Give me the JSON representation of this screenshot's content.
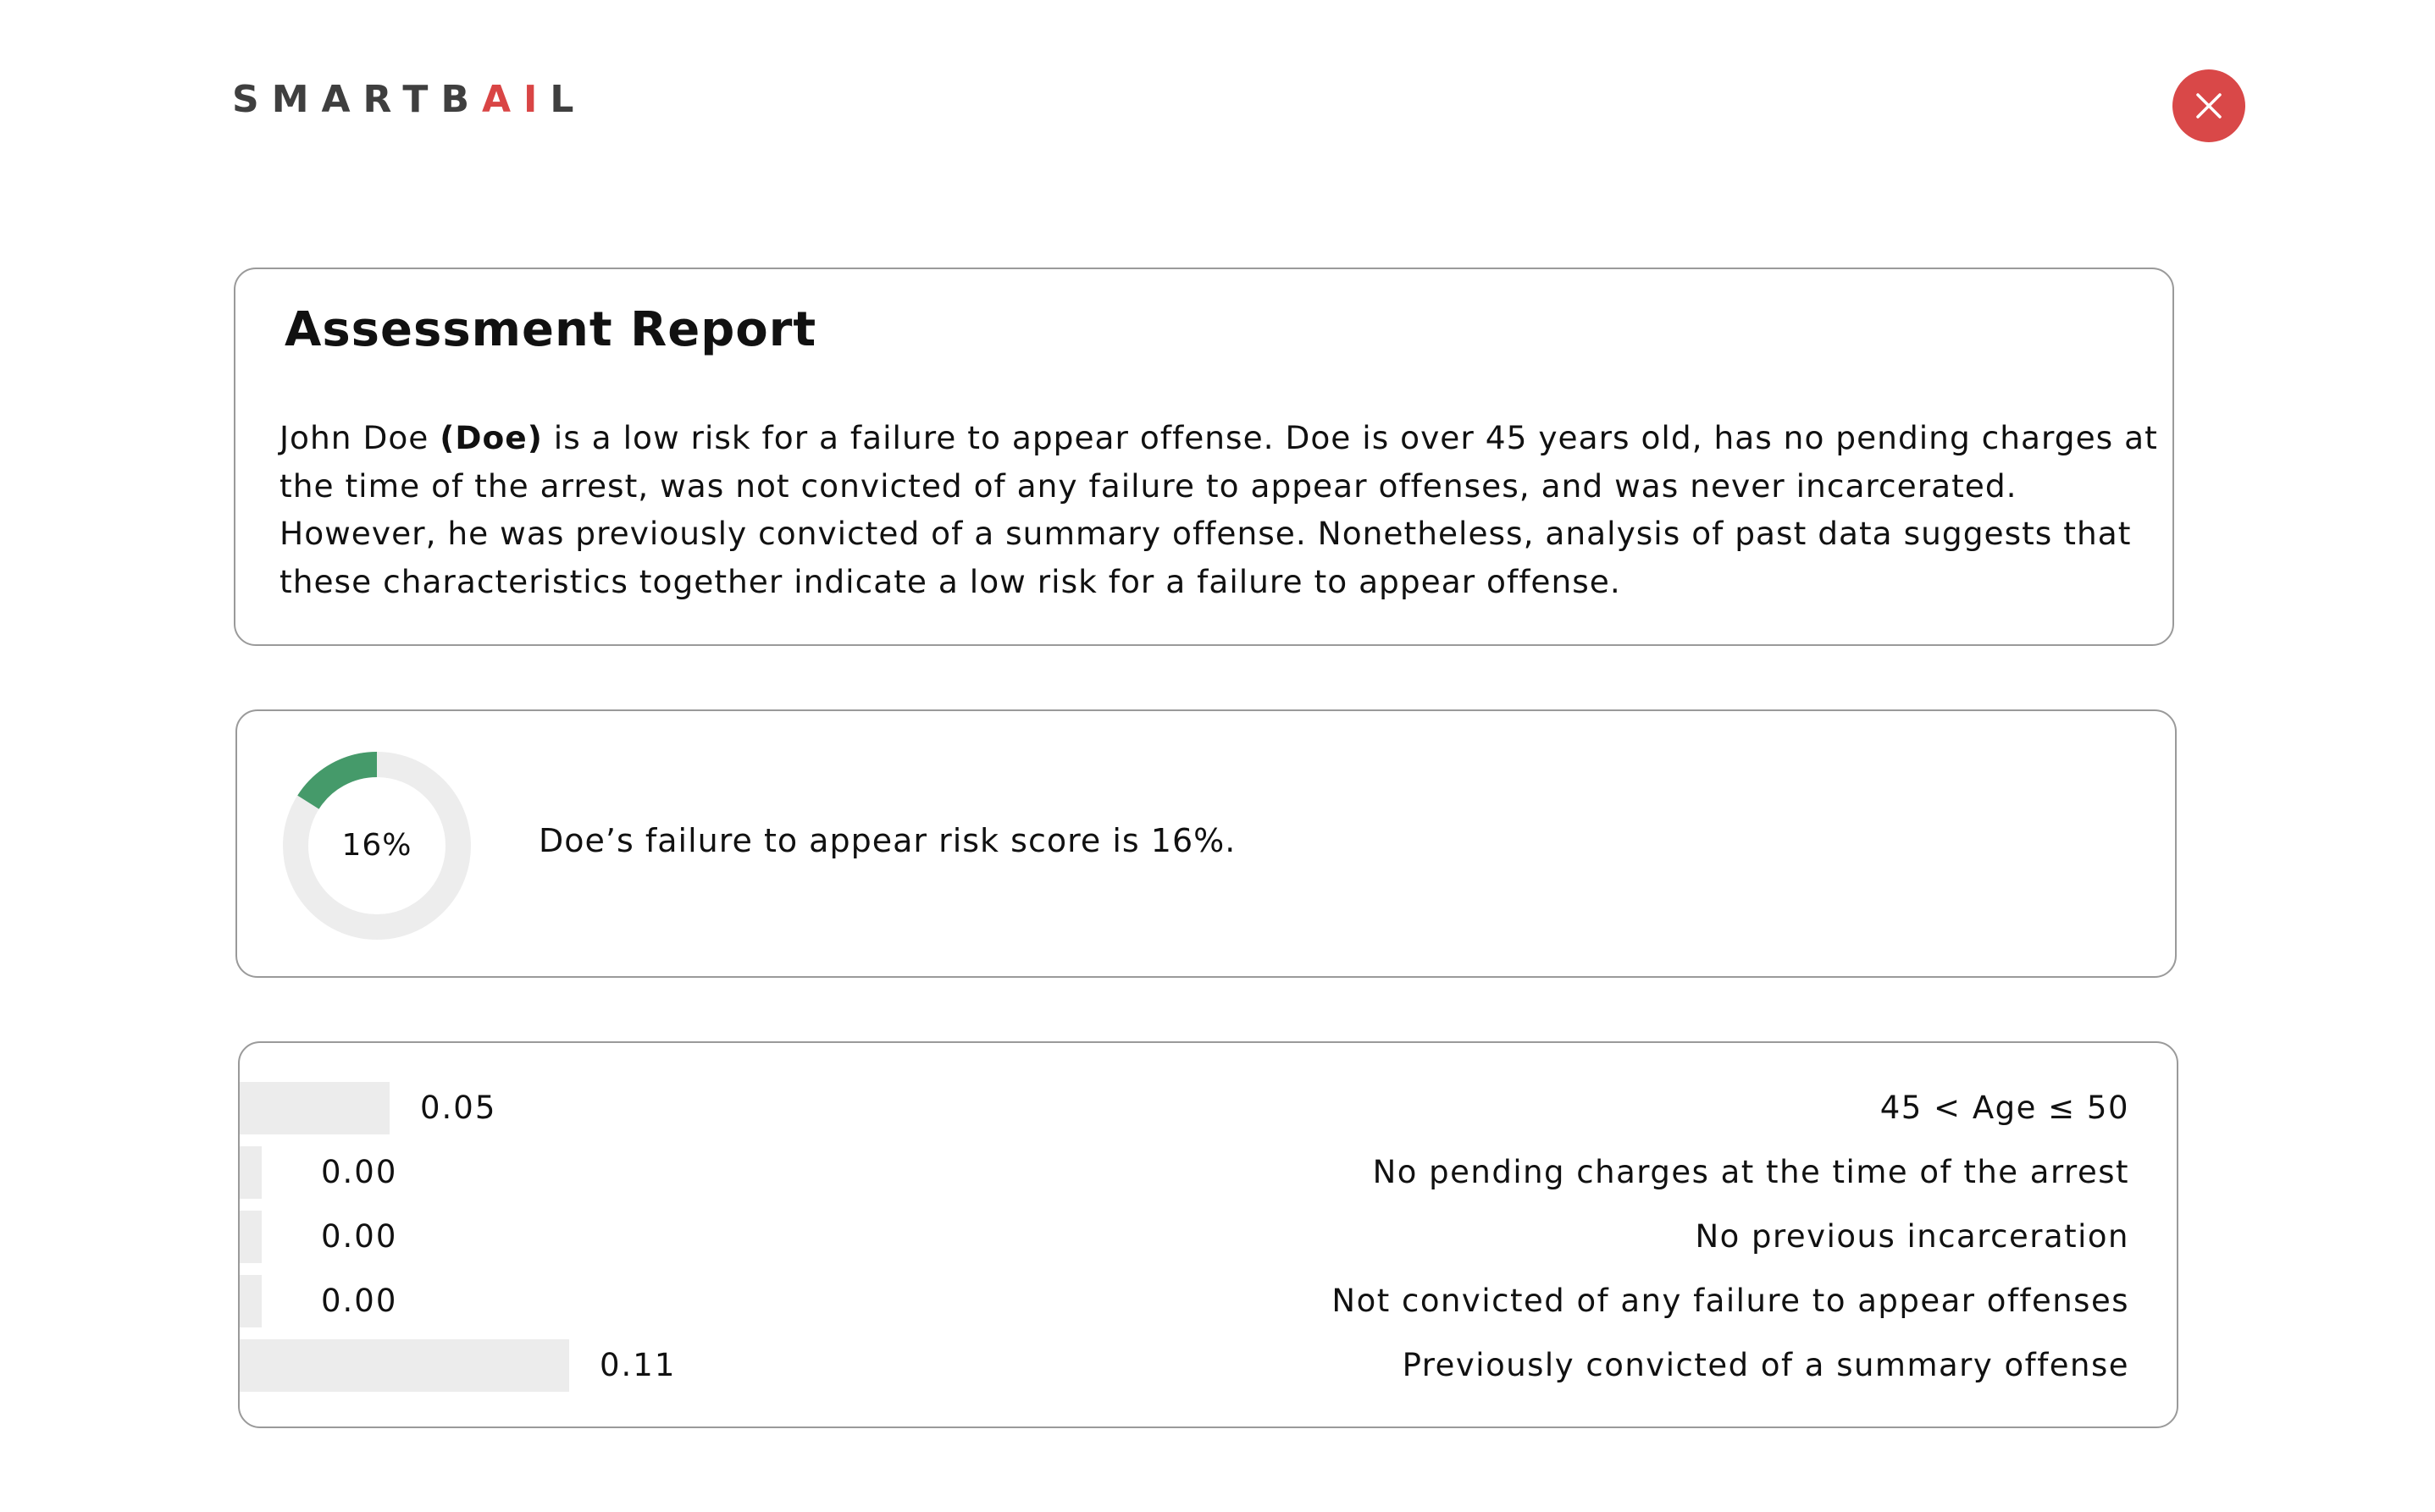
{
  "header": {
    "logo_prefix": "SMARTB",
    "logo_accent": "AI",
    "logo_suffix": "L",
    "close_icon": "close-icon",
    "accent_color": "#d94848"
  },
  "report": {
    "title": "Assessment Report",
    "lines": [
      {
        "before": "John Doe ",
        "bold": "(Doe)",
        "after": " is a low risk for a failure to appear offense. Doe is over 45 years old, has no pending charges at"
      },
      {
        "before": "the time of the arrest, was not convicted of any failure to appear offenses, and was never incarcerated."
      },
      {
        "before": "However, he was previously convicted of a summary offense. Nonetheless, analysis of past data suggests that"
      },
      {
        "before": "these characteristics together indicate a low risk for a failure to appear offense."
      }
    ]
  },
  "score": {
    "value_label": "16%",
    "fraction": 0.16,
    "text": "Doe’s failure to appear risk score is 16%.",
    "ring_color": "#459a6a",
    "track_color": "#ededed"
  },
  "factors": [
    {
      "value": 0.05,
      "value_label": "0.05",
      "label": "45 < Age ≤ 50"
    },
    {
      "value": 0.0,
      "value_label": "0.00",
      "label": "No pending charges at the time of the arrest"
    },
    {
      "value": 0.0,
      "value_label": "0.00",
      "label": "No previous incarceration"
    },
    {
      "value": 0.0,
      "value_label": "0.00",
      "label": "Not convicted of any failure to appear offenses"
    },
    {
      "value": 0.11,
      "value_label": "0.11",
      "label": "Previously convicted of a summary offense"
    }
  ]
}
